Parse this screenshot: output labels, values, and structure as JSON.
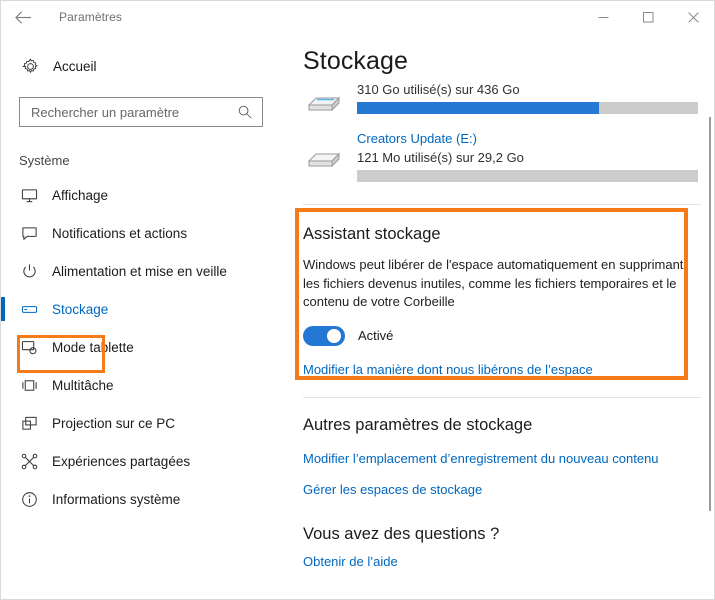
{
  "window": {
    "title": "Paramètres",
    "back_icon": "back-arrow-icon",
    "minimize_label": "–",
    "maximize_label": "□",
    "close_label": "✕"
  },
  "sidebar": {
    "home": {
      "label": "Accueil",
      "icon": "gear-icon"
    },
    "search": {
      "placeholder": "Rechercher un paramètre",
      "value": "",
      "icon": "search-icon"
    },
    "group_label": "Système",
    "items": [
      {
        "label": "Affichage",
        "icon": "monitor-icon",
        "selected": false
      },
      {
        "label": "Notifications et actions",
        "icon": "speech-bubble-icon",
        "selected": false
      },
      {
        "label": "Alimentation et mise en veille",
        "icon": "power-icon",
        "selected": false
      },
      {
        "label": "Stockage",
        "icon": "drive-icon",
        "selected": true
      },
      {
        "label": "Mode tablette",
        "icon": "tablet-mode-icon",
        "selected": false
      },
      {
        "label": "Multitâche",
        "icon": "multitask-icon",
        "selected": false
      },
      {
        "label": "Projection sur ce PC",
        "icon": "projection-icon",
        "selected": false
      },
      {
        "label": "Expériences partagées",
        "icon": "shared-experiences-icon",
        "selected": false
      },
      {
        "label": "Informations système",
        "icon": "info-icon",
        "selected": false
      }
    ]
  },
  "main": {
    "page_title": "Stockage",
    "drives": [
      {
        "name": "",
        "usage": "310 Go utilisé(s) sur 436 Go",
        "fill_percent": 71,
        "icon": "hard-drive-icon"
      },
      {
        "name": "Creators Update (E:)",
        "usage": "121 Mo utilisé(s) sur 29,2 Go",
        "fill_percent": 0,
        "icon": "hard-drive-icon"
      }
    ],
    "assistant": {
      "title": "Assistant stockage",
      "description": "Windows peut libérer de l'espace automatiquement en supprimant les fichiers devenus inutiles, comme les fichiers temporaires et le contenu de votre Corbeille",
      "toggle_state": "on",
      "toggle_label": "Activé",
      "link": "Modifier la manière dont nous libérons de l’espace"
    },
    "other_settings": {
      "title": "Autres paramètres de stockage",
      "links": [
        "Modifier l’emplacement d’enregistrement du nouveau contenu",
        "Gérer les espaces de stockage"
      ]
    },
    "questions": {
      "title": "Vous avez des questions ?",
      "link": "Obtenir de l’aide"
    }
  },
  "colors": {
    "accent_blue": "#0067c0",
    "progress_blue": "#2478d4",
    "highlight_orange": "#f57b18",
    "track_gray": "#cdcdcd"
  }
}
